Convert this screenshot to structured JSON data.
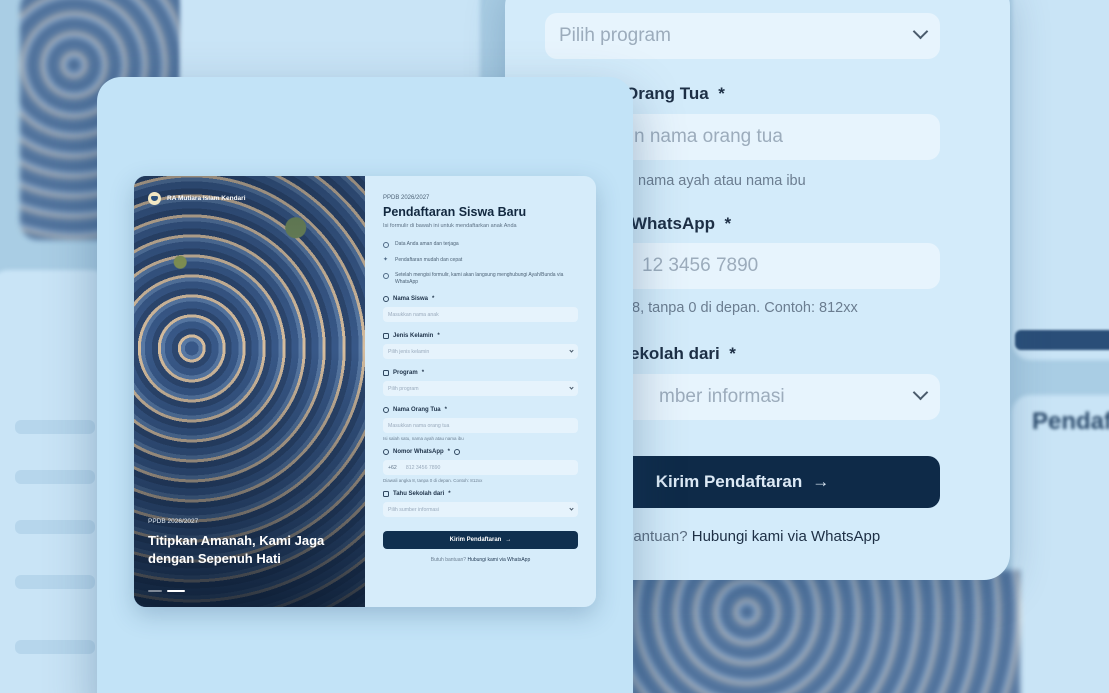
{
  "school": {
    "name": "RA Mutiara Islam Kendari"
  },
  "photo_panel": {
    "kicker": "PPDB 2026/2027",
    "headline": "Titipkan Amanah, Kami Jaga dengan Sepenuh Hati"
  },
  "form": {
    "kicker": "PPDB 2026/2027",
    "title": "Pendaftaran Siswa Baru",
    "subtitle": "Isi formulir di bawah ini untuk mendaftarkan anak Anda",
    "features": [
      "Data Anda aman dan terjaga",
      "Pendaftaran mudah dan cepat",
      "Setelah mengisi formulir, kami akan langsung menghubungi Ayah/Bunda via WhatsApp"
    ],
    "fields": {
      "nama_siswa": {
        "label": "Nama Siswa",
        "required": "*",
        "placeholder": "Masukkan nama anak"
      },
      "jenis_kelamin": {
        "label": "Jenis Kelamin",
        "required": "*",
        "placeholder": "Pilih jenis kelamin"
      },
      "program": {
        "label": "Program",
        "required": "*",
        "placeholder": "Pilih program"
      },
      "nama_orang_tua": {
        "label": "Nama Orang Tua",
        "required": "*",
        "placeholder": "Masukkan nama orang tua",
        "hint": "Isi salah satu, nama ayah atau nama ibu"
      },
      "whatsapp": {
        "label": "Nomor WhatsApp",
        "required": "*",
        "prefix": "+62",
        "placeholder": "812 3456 7890",
        "hint": "Diawali angka 8, tanpa 0 di depan. Contoh: 812xx"
      },
      "tahu_dari": {
        "label": "Tahu Sekolah dari",
        "required": "*",
        "placeholder": "Pilih sumber informasi"
      }
    },
    "submit_label": "Kirim Pendaftaran",
    "help_prefix": "Butuh bantuan?",
    "help_link": "Hubungi kami via WhatsApp"
  },
  "zoom_card": {
    "program_placeholder": "Pilih program",
    "parent_label": "Orang Tua",
    "required": "*",
    "parent_placeholder": "n nama orang tua",
    "parent_hint": "nama ayah atau nama ibu",
    "whatsapp_label": "WhatsApp",
    "whatsapp_placeholder": "12 3456 7890",
    "whatsapp_hint": "8, tanpa 0 di depan. Contoh: 812xx",
    "source_label": "ekolah dari",
    "source_placeholder": "mber informasi",
    "submit_label": "Kirim Pendaftaran",
    "help_prefix": "bantuan?",
    "help_link": "Hubungi kami via WhatsApp"
  },
  "background": {
    "blurred_title": "Pendaf"
  },
  "colors": {
    "primary": "#10304f",
    "panel": "#d6ecfa",
    "frame": "#c2e3f7"
  }
}
